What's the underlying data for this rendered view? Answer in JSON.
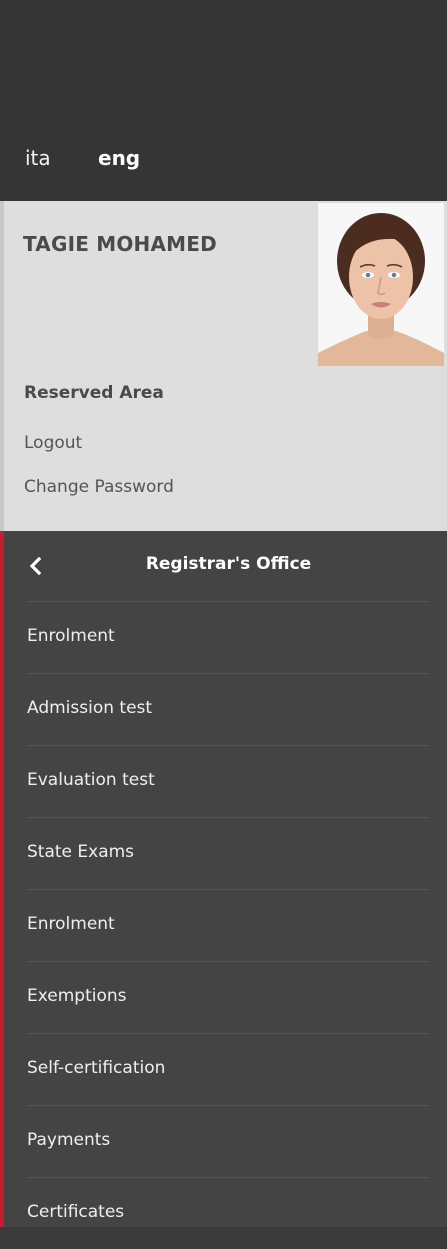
{
  "languages": {
    "ita": "ita",
    "eng": "eng"
  },
  "profile": {
    "name": "TAGIE MOHAMED",
    "section_heading": "Reserved Area",
    "links": {
      "logout": "Logout",
      "change_password": "Change Password"
    }
  },
  "nav": {
    "title": "Registrar's Office",
    "back_icon": "chevron-left-icon",
    "items": [
      {
        "label": "Enrolment"
      },
      {
        "label": "Admission test"
      },
      {
        "label": "Evaluation test"
      },
      {
        "label": "State Exams"
      },
      {
        "label": "Enrolment"
      },
      {
        "label": "Exemptions"
      },
      {
        "label": "Self-certification"
      },
      {
        "label": "Payments"
      },
      {
        "label": "Certificates"
      }
    ]
  },
  "colors": {
    "topbar": "#353535",
    "profile_bg": "#dedede",
    "nav_bg": "#444444",
    "accent": "#c0202e"
  }
}
